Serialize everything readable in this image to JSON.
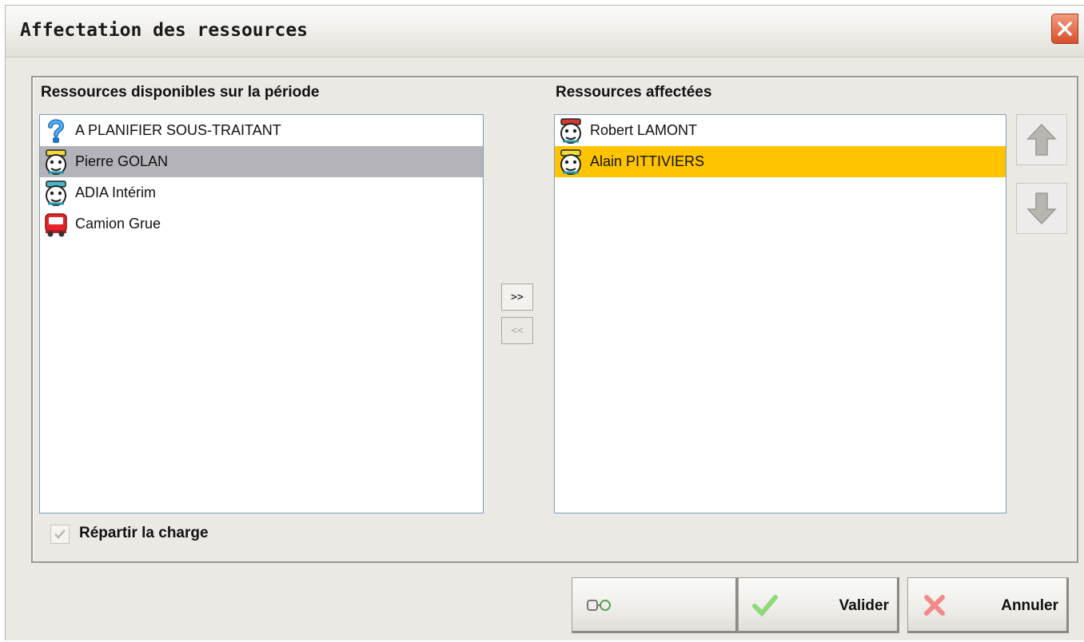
{
  "window": {
    "title": "Affectation des ressources",
    "close_icon": "close-icon"
  },
  "available": {
    "title": "Ressources disponibles sur la période",
    "items": [
      {
        "label": "A PLANIFIER SOUS-TRAITANT",
        "icon": "question-icon",
        "selected": false
      },
      {
        "label": "Pierre GOLAN",
        "icon": "worker-icon",
        "selected": true
      },
      {
        "label": "ADIA Intérim",
        "icon": "worker-icon",
        "selected": false
      },
      {
        "label": "Camion Grue",
        "icon": "truck-icon",
        "selected": false
      }
    ]
  },
  "assigned": {
    "title": "Ressources affectées",
    "items": [
      {
        "label": "Robert LAMONT",
        "icon": "worker-icon",
        "selected": false
      },
      {
        "label": "Alain PITTIVIERS",
        "icon": "worker-icon",
        "selected": true
      }
    ]
  },
  "transfer": {
    "add_label": ">>",
    "remove_label": "<<"
  },
  "order": {
    "up_icon": "arrow-up-icon",
    "down_icon": "arrow-down-icon"
  },
  "options": {
    "spread_load_label": "Répartir la charge",
    "spread_load_checked": true
  },
  "buttons": {
    "link_icon": "link-icon",
    "validate_label": "Valider",
    "cancel_label": "Annuler"
  },
  "colors": {
    "selected_grey": "#b3b3b9",
    "selected_yellow": "#ffc400",
    "close_red": "#d8502c"
  }
}
